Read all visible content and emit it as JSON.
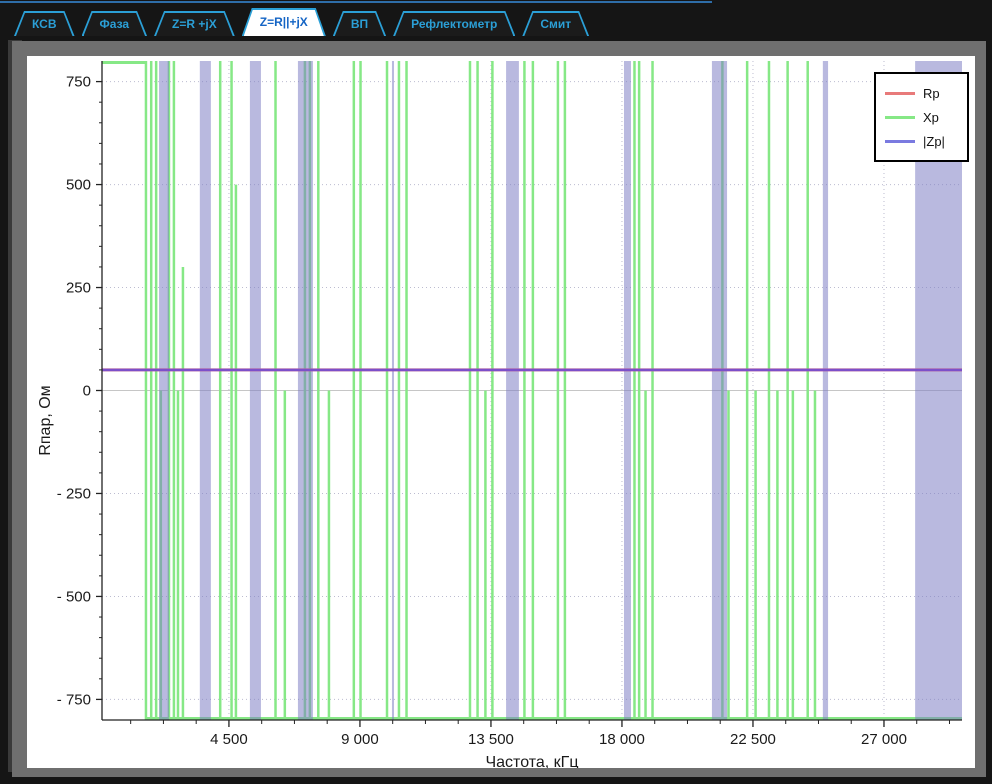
{
  "window": {
    "bg": "#151515",
    "frame_color": "#6f6f6f",
    "panel_color": "#ffffff",
    "tab_border_color": "#2b9fd6",
    "tab_active_text_color": "#1565c5"
  },
  "tabs": {
    "items": [
      {
        "label": "КСВ",
        "active": false
      },
      {
        "label": "Фаза",
        "active": false
      },
      {
        "label": "Z=R +jX",
        "active": false
      },
      {
        "label": "Z=R||+jX",
        "active": true
      },
      {
        "label": "ВП",
        "active": false
      },
      {
        "label": "Рефлектометр",
        "active": false
      },
      {
        "label": "Смит",
        "active": false
      }
    ]
  },
  "legend": {
    "items": [
      {
        "label": "Rp",
        "color": "#e87a7a"
      },
      {
        "label": "Xp",
        "color": "#86e886"
      },
      {
        "label": "|Zp|",
        "color": "#7a7ae0"
      }
    ]
  },
  "chart_data": {
    "type": "line",
    "title": "",
    "xlabel": "Частота, кГц",
    "ylabel": "Rпар, Ом",
    "xlim": [
      140,
      29680
    ],
    "ylim": [
      -800,
      800
    ],
    "x_ticks": [
      {
        "v": 4500,
        "label": "4 500"
      },
      {
        "v": 9000,
        "label": "9 000"
      },
      {
        "v": 13500,
        "label": "13 500"
      },
      {
        "v": 18000,
        "label": "18 000"
      },
      {
        "v": 22500,
        "label": "22 500"
      },
      {
        "v": 27000,
        "label": "27 000"
      }
    ],
    "y_ticks": [
      {
        "v": 750,
        "label": "750"
      },
      {
        "v": 500,
        "label": "500"
      },
      {
        "v": 250,
        "label": "250"
      },
      {
        "v": 0,
        "label": "0"
      },
      {
        "v": -250,
        "label": "- 250"
      },
      {
        "v": -500,
        "label": "- 500"
      },
      {
        "v": -750,
        "label": "- 750"
      }
    ],
    "x_minor_step": 1125,
    "y_minor_step": 50,
    "grid": {
      "dotted_color": "#bcbcd0",
      "zero_line_color": "#c6c6c6"
    },
    "series": [
      {
        "name": "Rp",
        "color": "#e87a7a",
        "type": "constant",
        "value": 50
      },
      {
        "name": "Xp",
        "color": "#86e886",
        "type": "spikes",
        "clip_top_segment": [
          140,
          1650
        ],
        "clip_bottom_segment": [
          1650,
          29680
        ],
        "spikes": [
          [
            1650,
            800
          ],
          [
            1830,
            800
          ],
          [
            2000,
            800
          ],
          [
            2160,
            0
          ],
          [
            2440,
            800
          ],
          [
            2610,
            800
          ],
          [
            2750,
            0
          ],
          [
            2920,
            300
          ],
          [
            4200,
            800
          ],
          [
            4590,
            800
          ],
          [
            4740,
            500
          ],
          [
            6100,
            800
          ],
          [
            6420,
            0
          ],
          [
            7110,
            800
          ],
          [
            7280,
            800
          ],
          [
            7570,
            800
          ],
          [
            7935,
            0
          ],
          [
            8790,
            800
          ],
          [
            9020,
            800
          ],
          [
            9930,
            800
          ],
          [
            10340,
            800
          ],
          [
            10600,
            800
          ],
          [
            12780,
            800
          ],
          [
            13040,
            800
          ],
          [
            13310,
            0
          ],
          [
            13550,
            800
          ],
          [
            14650,
            800
          ],
          [
            14940,
            800
          ],
          [
            15800,
            800
          ],
          [
            16040,
            800
          ],
          [
            18430,
            800
          ],
          [
            18590,
            800
          ],
          [
            18810,
            0
          ],
          [
            19050,
            800
          ],
          [
            21450,
            800
          ],
          [
            21660,
            0
          ],
          [
            22300,
            800
          ],
          [
            22590,
            0
          ],
          [
            23050,
            800
          ],
          [
            23340,
            0
          ],
          [
            23690,
            800
          ],
          [
            23870,
            0
          ],
          [
            24380,
            800
          ],
          [
            24630,
            0
          ]
        ]
      },
      {
        "name": "|Zp|",
        "color": "#7a7ae0",
        "type": "constant_with_saturation_bands",
        "value": 50,
        "drawn_line_color": "#7d4fc9",
        "band_fill": "rgba(128,128,196,0.55)",
        "saturated_bands": [
          [
            2100,
            2440
          ],
          [
            3500,
            3880
          ],
          [
            5220,
            5600
          ],
          [
            6870,
            7385
          ],
          [
            10100,
            10170
          ],
          [
            14020,
            14460
          ],
          [
            18070,
            18310
          ],
          [
            21090,
            21610
          ],
          [
            24900,
            25080
          ],
          [
            28070,
            29680
          ]
        ]
      }
    ]
  }
}
